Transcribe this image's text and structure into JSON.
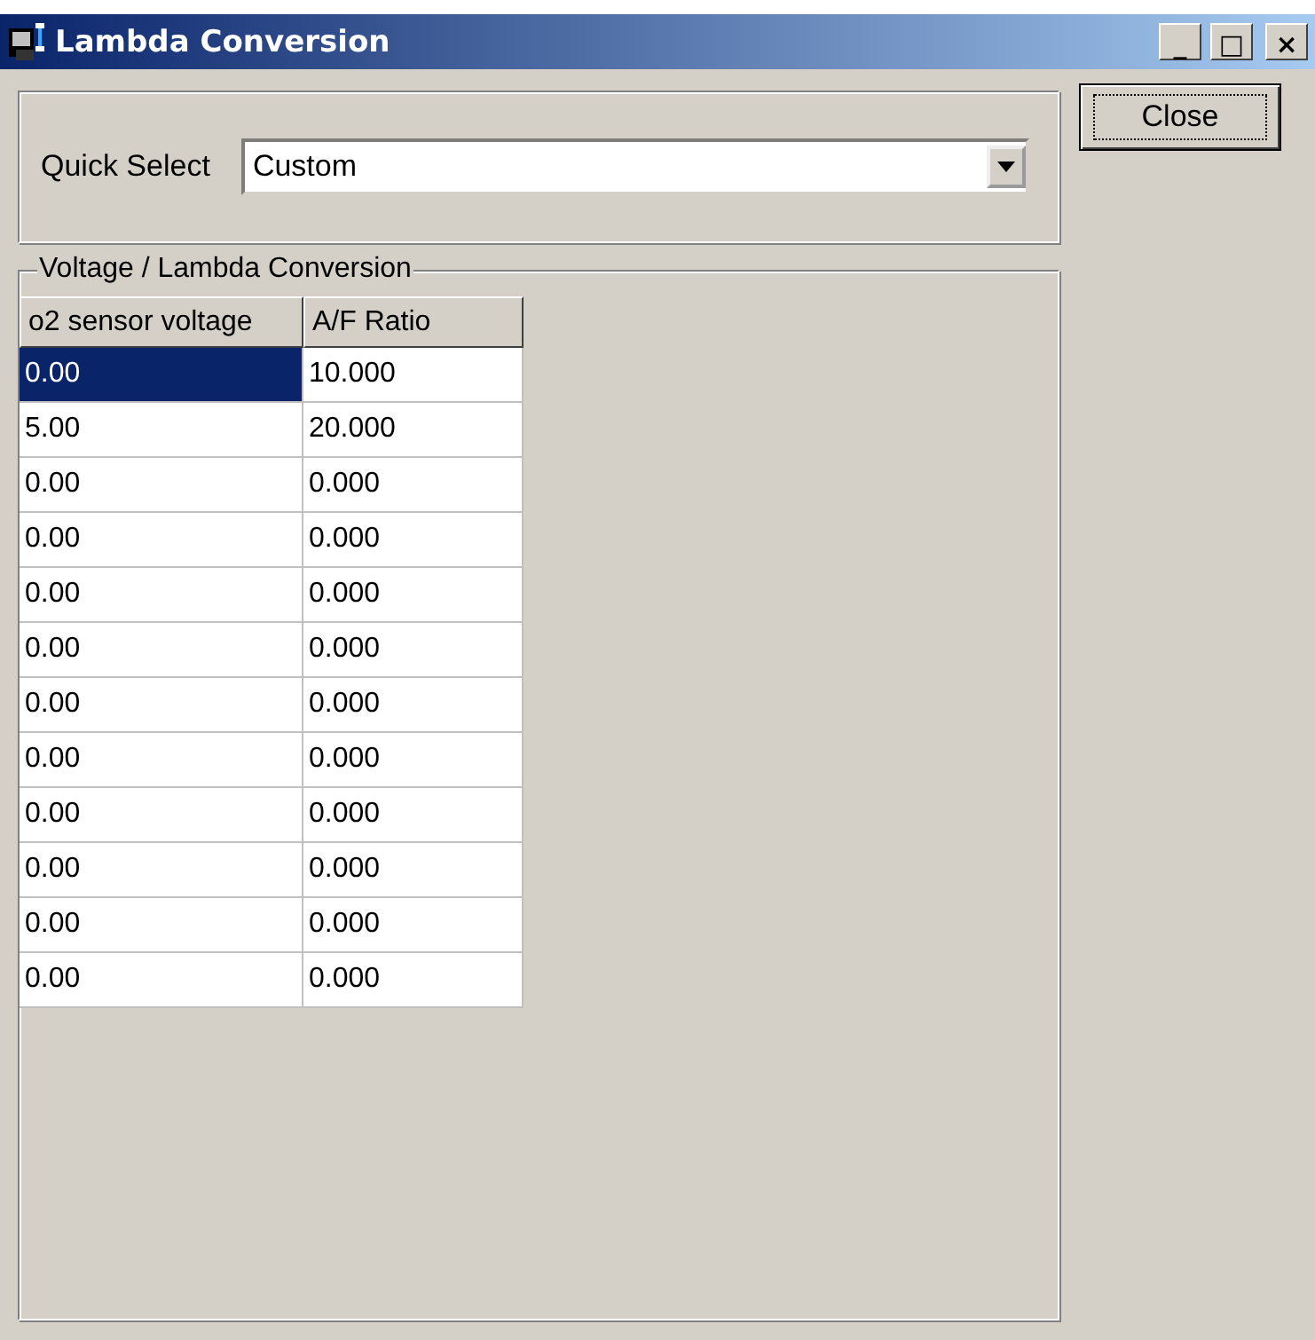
{
  "window": {
    "title": "Lambda Conversion",
    "controls": [
      "_",
      "□",
      "×"
    ]
  },
  "quick_select": {
    "label": "Quick Select",
    "value": "Custom"
  },
  "close_button": {
    "label": "Close",
    "focused": true
  },
  "group": {
    "title": "Voltage / Lambda Conversion"
  },
  "table": {
    "columns": [
      "o2 sensor voltage",
      "A/F Ratio"
    ],
    "rows": [
      [
        {
          "text": "0.00",
          "selected": true
        },
        {
          "text": "10.000",
          "selected": false
        }
      ],
      [
        {
          "text": "5.00",
          "selected": false
        },
        {
          "text": "20.000",
          "selected": false
        }
      ],
      [
        {
          "text": "0.00",
          "selected": false
        },
        {
          "text": "0.000",
          "selected": false
        }
      ],
      [
        {
          "text": "0.00",
          "selected": false
        },
        {
          "text": "0.000",
          "selected": false
        }
      ],
      [
        {
          "text": "0.00",
          "selected": false
        },
        {
          "text": "0.000",
          "selected": false
        }
      ],
      [
        {
          "text": "0.00",
          "selected": false
        },
        {
          "text": "0.000",
          "selected": false
        }
      ],
      [
        {
          "text": "0.00",
          "selected": false
        },
        {
          "text": "0.000",
          "selected": false
        }
      ],
      [
        {
          "text": "0.00",
          "selected": false
        },
        {
          "text": "0.000",
          "selected": false
        }
      ],
      [
        {
          "text": "0.00",
          "selected": false
        },
        {
          "text": "0.000",
          "selected": false
        }
      ],
      [
        {
          "text": "0.00",
          "selected": false
        },
        {
          "text": "0.000",
          "selected": false
        }
      ],
      [
        {
          "text": "0.00",
          "selected": false
        },
        {
          "text": "0.000",
          "selected": false
        }
      ],
      [
        {
          "text": "0.00",
          "selected": false
        },
        {
          "text": "0.000",
          "selected": false
        }
      ]
    ]
  }
}
